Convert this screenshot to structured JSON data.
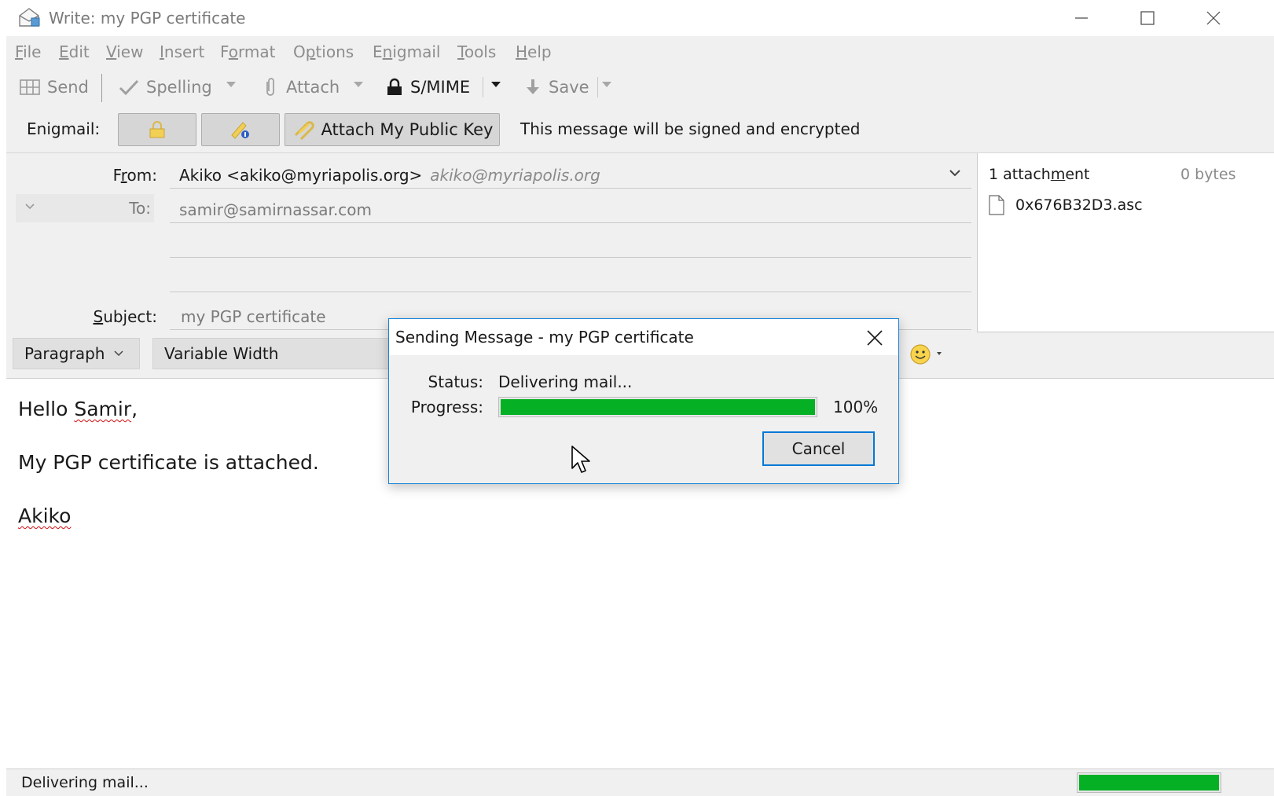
{
  "window": {
    "title": "Write: my PGP certificate"
  },
  "menu": {
    "items": [
      {
        "label": "File",
        "accel": "F",
        "rest": "ile"
      },
      {
        "label": "Edit",
        "accel": "E",
        "rest": "dit"
      },
      {
        "label": "View",
        "accel": "V",
        "rest": "iew"
      },
      {
        "label": "Insert",
        "accel": "I",
        "rest": "nsert"
      },
      {
        "label": "Format",
        "pre": "F",
        "accel": "o",
        "rest": "rmat"
      },
      {
        "label": "Options",
        "pre": "O",
        "accel": "p",
        "rest": "tions"
      },
      {
        "label": "Enigmail",
        "pre": "E",
        "accel": "n",
        "rest": "igmail"
      },
      {
        "label": "Tools",
        "accel": "T",
        "rest": "ools"
      },
      {
        "label": "Help",
        "accel": "H",
        "rest": "elp"
      }
    ]
  },
  "toolbar": {
    "send_label": "Send",
    "spelling_label": "Spelling",
    "attach_label": "Attach",
    "smime_label": "S/MIME",
    "save_label": "Save"
  },
  "enigmail": {
    "label": "Enigmail:",
    "attach_key_label": "Attach My Public Key",
    "status": "This message will be signed and encrypted"
  },
  "header": {
    "from_label": "From:",
    "from_value": "Akiko <akiko@myriapolis.org>",
    "from_alt": "akiko@myriapolis.org",
    "to_label": "To:",
    "to_value": "samir@samirnassar.com",
    "subject_label": "Subject:",
    "subject_value": "my PGP certificate"
  },
  "attachments": {
    "header": "1 attachment",
    "size": "0 bytes",
    "items": [
      {
        "name": "0x676B32D3.asc"
      }
    ]
  },
  "format": {
    "paragraph": "Paragraph",
    "font": "Variable Width"
  },
  "body": {
    "greeting_prefix": "Hello ",
    "greeting_name": "Samir",
    "greeting_suffix": ",",
    "line2": "My PGP certificate is attached.",
    "signature": "Akiko"
  },
  "statusbar": {
    "text": "Delivering mail...",
    "progress": 1.0
  },
  "dialog": {
    "title": "Sending Message - my PGP certificate",
    "status_label": "Status:",
    "status_value": "Delivering mail...",
    "progress_label": "Progress:",
    "progress_value": 1.0,
    "progress_text": "100%",
    "cancel_label": "Cancel"
  },
  "colors": {
    "progress": "#06b025",
    "dialog_border": "#1883d7",
    "focus": "#0078d7"
  }
}
